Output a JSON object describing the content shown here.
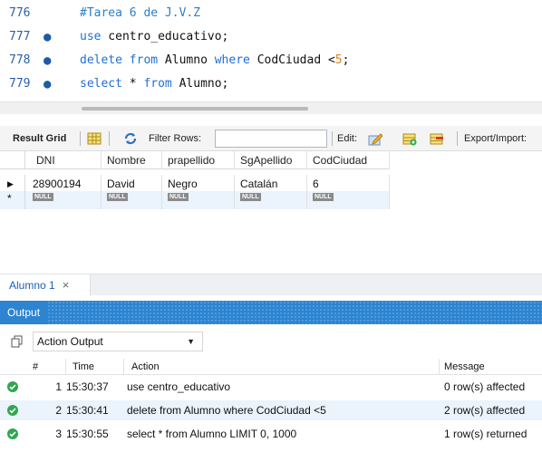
{
  "editor": {
    "lines": [
      {
        "num": "776",
        "comment": "#Tarea 6 de J.V.Z"
      },
      {
        "num": "777",
        "kw1": "use",
        "rest": " centro_educativo;"
      },
      {
        "num": "778",
        "kw1": "delete",
        "mid1": " ",
        "kw2": "from",
        "mid2": " Alumno ",
        "kw3": "where",
        "mid3": " CodCiudad <",
        "numval": "5",
        "end": ";"
      },
      {
        "num": "779",
        "kw1": "select",
        "mid1": " * ",
        "kw2": "from",
        "rest": " Alumno;"
      }
    ]
  },
  "grid_toolbar": {
    "result_grid": "Result Grid",
    "filter_rows": "Filter Rows:",
    "filter_value": "",
    "edit": "Edit:",
    "export": "Export/Import:"
  },
  "grid": {
    "columns": [
      "DNI",
      "Nombre",
      "prapellido",
      "SgApellido",
      "CodCiudad"
    ],
    "rows": [
      [
        "28900194",
        "David",
        "Negro",
        "Catalán",
        "6"
      ]
    ],
    "null_label": "NULL"
  },
  "result_tab": {
    "label": "Alumno 1",
    "close": "×"
  },
  "output": {
    "title": "Output",
    "mode": "Action Output",
    "columns": {
      "num": "#",
      "time": "Time",
      "action": "Action",
      "message": "Message"
    },
    "rows": [
      {
        "num": "1",
        "time": "15:30:37",
        "action": "use centro_educativo",
        "message": "0 row(s) affected"
      },
      {
        "num": "2",
        "time": "15:30:41",
        "action": "delete from Alumno where CodCiudad <5",
        "message": "2 row(s) affected"
      },
      {
        "num": "3",
        "time": "15:30:55",
        "action": "select * from Alumno LIMIT 0, 1000",
        "message": "1 row(s) returned"
      }
    ]
  }
}
